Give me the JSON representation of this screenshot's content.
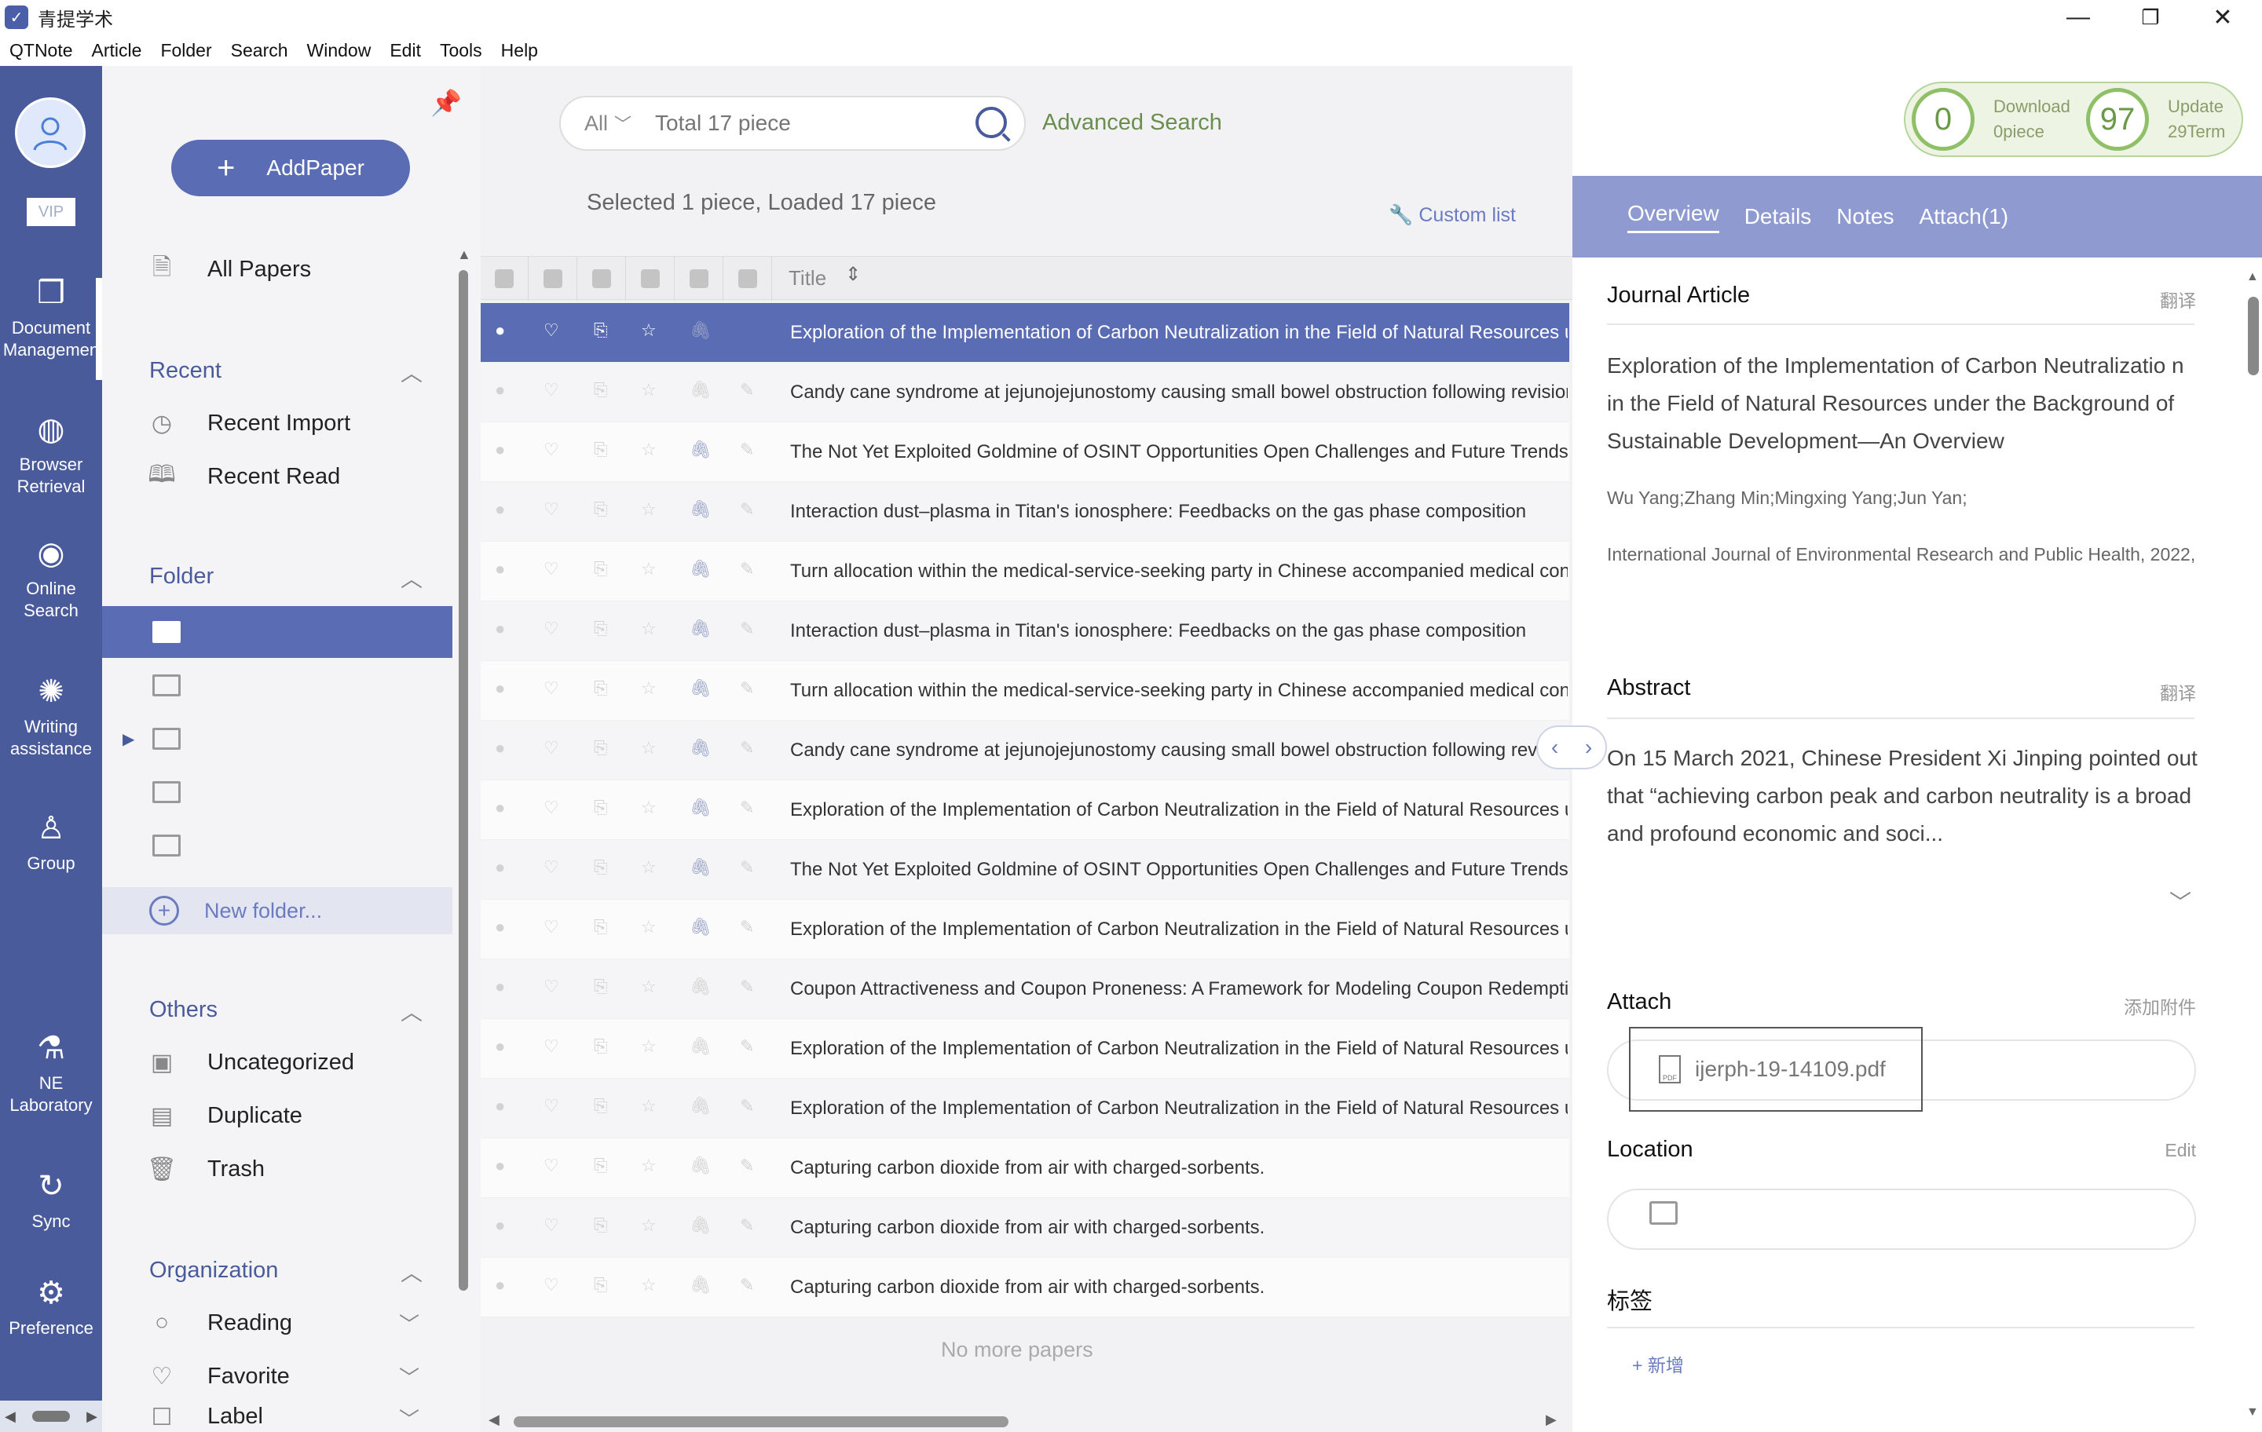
{
  "window": {
    "title": "青提学术",
    "controls": [
      "—",
      "❐",
      "✕"
    ]
  },
  "menu": [
    "QTNote",
    "Article",
    "Folder",
    "Search",
    "Window",
    "Edit",
    "Tools",
    "Help"
  ],
  "rail": {
    "vip": "VIP",
    "items": [
      {
        "line1": "Document",
        "line2": "Managemen",
        "icon": "box-icon"
      },
      {
        "line1": "Browser",
        "line2": "Retrieval",
        "icon": "globe-icon"
      },
      {
        "line1": "Online",
        "line2": "Search",
        "icon": "eye-icon"
      },
      {
        "line1": "Writing",
        "line2": "assistance",
        "icon": "bulb-icon"
      },
      {
        "line1": "Group",
        "line2": "",
        "icon": "people-icon"
      },
      {
        "line1": "NE",
        "line2": "Laboratory",
        "icon": "microscope-icon"
      },
      {
        "line1": "Sync",
        "line2": "",
        "icon": "sync-icon"
      },
      {
        "line1": "Preference",
        "line2": "",
        "icon": "gear-icon"
      }
    ]
  },
  "sidebar": {
    "add_paper": "AddPaper",
    "all_papers": "All Papers",
    "recent": {
      "title": "Recent",
      "items": [
        "Recent Import",
        "Recent Read"
      ]
    },
    "folder": {
      "title": "Folder",
      "new_folder": "New folder..."
    },
    "others": {
      "title": "Others",
      "items": [
        "Uncategorized",
        "Duplicate",
        "Trash"
      ]
    },
    "organization": {
      "title": "Organization",
      "items": [
        "Reading",
        "Favorite",
        "Label"
      ]
    }
  },
  "search": {
    "scope": "All",
    "placeholder": "Total 17 piece",
    "advanced": "Advanced Search"
  },
  "status": {
    "download_count": "0",
    "download_label": "Download",
    "download_sub": "0piece",
    "update_count": "97",
    "update_label": "Update",
    "update_sub": "29Term"
  },
  "list": {
    "summary": "Selected 1 piece,   Loaded 17 piece",
    "custom_list": "Custom list",
    "title_col": "Title",
    "no_more": "No more papers",
    "rows": [
      {
        "title": "Exploration of the Implementation of Carbon Neutralization in the Field of Natural Resources under the Background of Sustainable Development—An Overview",
        "attach": true
      },
      {
        "title": "Candy cane syndrome at jejunojejunostomy causing small bowel obstruction following revisional bariatric surgery",
        "attach": false
      },
      {
        "title": "The Not Yet Exploited Goldmine of OSINT Opportunities Open Challenges and Future Trends",
        "attach": true
      },
      {
        "title": "Interaction dust–plasma in Titan's ionosphere: Feedbacks on the gas phase composition",
        "attach": true
      },
      {
        "title": "Turn allocation within the medical-service-seeking party in Chinese accompanied medical consultations",
        "attach": true
      },
      {
        "title": "Interaction dust–plasma in Titan's ionosphere: Feedbacks on the gas phase composition",
        "attach": true
      },
      {
        "title": "Turn allocation within the medical-service-seeking party in Chinese accompanied medical consultations",
        "attach": true
      },
      {
        "title": "Candy cane syndrome at jejunojejunostomy causing small bowel obstruction following revisional bariatric surgery",
        "attach": true
      },
      {
        "title": "Exploration of the Implementation of Carbon Neutralization in the Field of Natural Resources under the Background of Sustainable Development—An Overview",
        "attach": true
      },
      {
        "title": "The Not Yet Exploited Goldmine of OSINT Opportunities Open Challenges and Future Trends",
        "attach": true
      },
      {
        "title": "Exploration of the Implementation of Carbon Neutralization in the Field of Natural Resources under the Background of Sustainable Development—An Overview",
        "attach": true
      },
      {
        "title": "Coupon Attractiveness and Coupon Proneness: A Framework for Modeling Coupon Redemption",
        "attach": false
      },
      {
        "title": "Exploration of the Implementation of Carbon Neutralization in the Field of Natural Resources under the Background of Sustainable Development—An Overview",
        "attach": false
      },
      {
        "title": "Exploration of the Implementation of Carbon Neutralization in the Field of Natural Resources under the Background of Sustainable Development—An Overview",
        "attach": false
      },
      {
        "title": "Capturing carbon dioxide from air with charged-sorbents.",
        "attach": false
      },
      {
        "title": "Capturing carbon dioxide from air with charged-sorbents.",
        "attach": false
      },
      {
        "title": "Capturing carbon dioxide from air with charged-sorbents.",
        "attach": false
      }
    ]
  },
  "detail": {
    "tabs": [
      "Overview",
      "Details",
      "Notes",
      "Attach(1)"
    ],
    "type": "Journal Article",
    "translate": "翻译",
    "title_text": "Exploration of the Implementation of Carbon Neutralizatio n in the Field of Natural Resources under the Background of Sustainable Development—An Overview",
    "authors": "Wu Yang;Zhang Min;Mingxing Yang;Jun Yan;",
    "journal": "International Journal of Environmental Research and Public Health, 2022,",
    "abstract_title": "Abstract",
    "abstract": "On 15 March 2021, Chinese President Xi Jinping pointed out that “achieving carbon peak and carbon neutrality is a broad and profound economic and soci...",
    "attach_title": "Attach",
    "attach_add": "添加附件",
    "attach_file": "ijerph-19-14109.pdf",
    "location_title": "Location",
    "location_edit": "Edit",
    "tags_title": "标签",
    "tags_add": "+ 新增"
  }
}
